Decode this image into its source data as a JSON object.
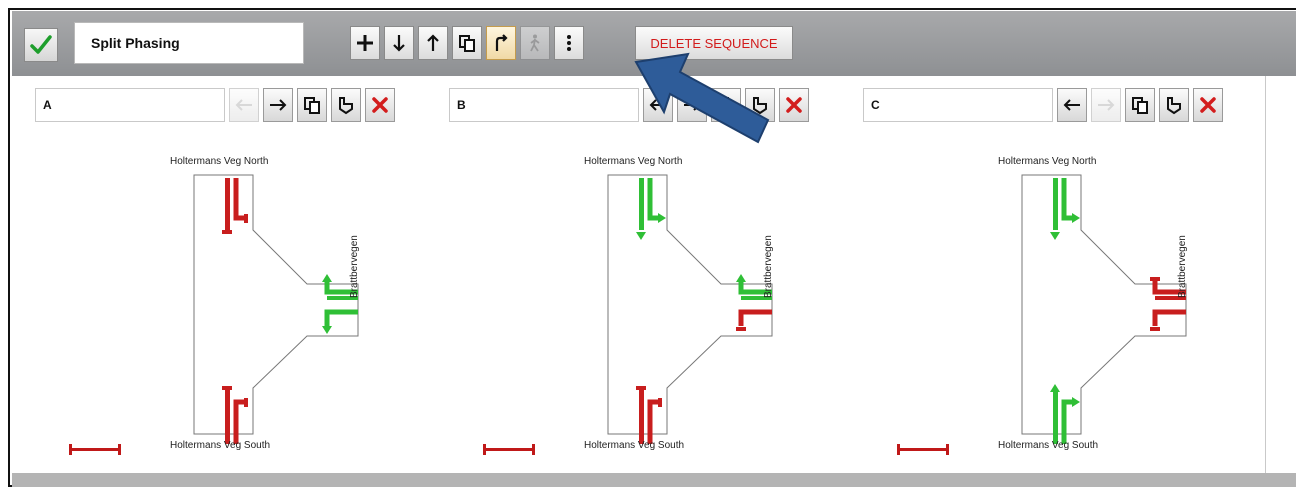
{
  "sequence": {
    "name": "Split Phasing"
  },
  "toolbar": {
    "buttons": [
      {
        "name": "add-phase-button",
        "icon": "plus-icon",
        "state": "normal"
      },
      {
        "name": "move-down-button",
        "icon": "arrow-down-icon",
        "state": "normal"
      },
      {
        "name": "move-up-button",
        "icon": "arrow-up-icon",
        "state": "normal"
      },
      {
        "name": "copy-phase-button",
        "icon": "copy-icon",
        "state": "normal"
      },
      {
        "name": "turn-right-button",
        "icon": "turn-right-icon",
        "state": "active"
      },
      {
        "name": "pedestrian-button",
        "icon": "pedestrian-icon",
        "state": "disabled"
      },
      {
        "name": "more-options-button",
        "icon": "vertical-dots-icon",
        "state": "normal"
      }
    ],
    "delete_label": "DELETE SEQUENCE"
  },
  "panels": [
    {
      "name": "A",
      "left_disabled": true,
      "right_disabled": false,
      "movements": {
        "north": "red",
        "east_upper": "green",
        "east_lower": "green",
        "south": "red"
      }
    },
    {
      "name": "B",
      "left_disabled": false,
      "right_disabled": false,
      "movements": {
        "north": "green",
        "east_upper": "green",
        "east_lower": "red",
        "south": "red"
      }
    },
    {
      "name": "C",
      "left_disabled": false,
      "right_disabled": true,
      "movements": {
        "north": "green",
        "east_upper": "red",
        "east_lower": "red",
        "south": "green"
      }
    }
  ],
  "roads": {
    "north": "Holtermans Veg North",
    "south": "Holtermans Veg South",
    "east": "Brattbervegen"
  },
  "colors": {
    "green": "#2fbf36",
    "red": "#c81e1e",
    "accent": "#2e5c99"
  }
}
